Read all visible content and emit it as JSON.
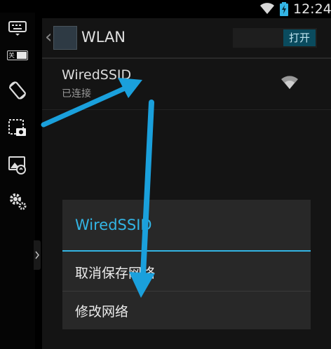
{
  "status_bar": {
    "time": "12:24",
    "icons": [
      "wifi-icon",
      "battery-charging-icon"
    ]
  },
  "toolbar": {
    "tools": [
      "keyboard-icon",
      "toggle-off-icon",
      "rotate-screen-icon",
      "screenshot-icon",
      "gallery-icon",
      "settings-icon"
    ],
    "toggle_label": "关"
  },
  "action_bar": {
    "title": "WLAN",
    "switch_label": "打开"
  },
  "network": {
    "ssid": "WiredSSID",
    "status": "已连接",
    "signal_icon": "wifi-signal-icon"
  },
  "dialog": {
    "title": "WiredSSID",
    "items": [
      "取消保存网络",
      "修改网络"
    ]
  },
  "colors": {
    "accent": "#33b5e5",
    "arrow": "#1aa0dc"
  }
}
